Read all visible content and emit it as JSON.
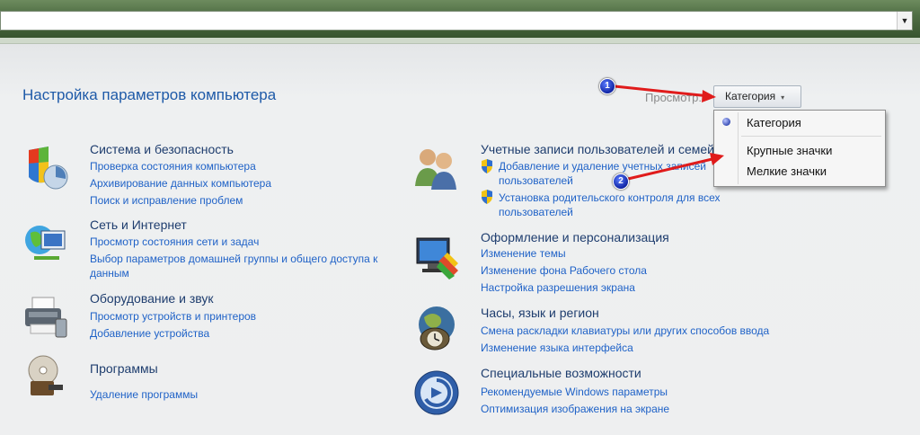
{
  "window": {
    "address_arrow": "▼"
  },
  "header": {
    "title": "Настройка параметров компьютера",
    "view_label": "Просмотр:",
    "view_value": "Категория",
    "view_arrow": "▾"
  },
  "dropdown": {
    "items": [
      "Категория",
      "Крупные значки",
      "Мелкие значки"
    ],
    "selected": "Категория"
  },
  "annotations": {
    "badge1": "1",
    "badge2": "2",
    "arrow_color": "#e01b1b"
  },
  "categories_left": [
    {
      "title": "Система и безопасность",
      "icon": "shield-system-icon",
      "links": [
        "Проверка состояния компьютера",
        "Архивирование данных компьютера",
        "Поиск и исправление проблем"
      ]
    },
    {
      "title": "Сеть и Интернет",
      "icon": "network-globe-icon",
      "links": [
        "Просмотр состояния сети и задач",
        "Выбор параметров домашней группы и общего доступа к",
        "данным"
      ]
    },
    {
      "title": "Оборудование и звук",
      "icon": "printer-icon",
      "links": [
        "Просмотр устройств и принтеров",
        "Добавление устройства"
      ]
    },
    {
      "title": "Программы",
      "icon": "programs-disk-icon",
      "links": [
        "Удаление программы"
      ]
    }
  ],
  "categories_right": [
    {
      "title": "Учетные записи пользователей и семейная безопасность",
      "icon": "users-icon",
      "links": [
        "Добавление и удаление учетных записей",
        "пользователей",
        "Установка родительского контроля для всех",
        "пользователей"
      ]
    },
    {
      "title": "Оформление и персонализация",
      "icon": "monitor-palette-icon",
      "links": [
        "Изменение темы",
        "Изменение фона Рабочего стола",
        "Настройка разрешения экрана"
      ]
    },
    {
      "title": "Часы, язык и регион",
      "icon": "clock-globe-icon",
      "links": [
        "Смена раскладки клавиатуры или других способов ввода",
        "Изменение языка интерфейса"
      ]
    },
    {
      "title": "Специальные возможности",
      "icon": "accessibility-icon",
      "links": [
        "Рекомендуемые Windows параметры",
        "Оптимизация изображения на экране"
      ]
    }
  ],
  "colors": {
    "link": "#1f62c7",
    "category_title": "#1e3d6e",
    "page_title": "#1e5aa8"
  }
}
